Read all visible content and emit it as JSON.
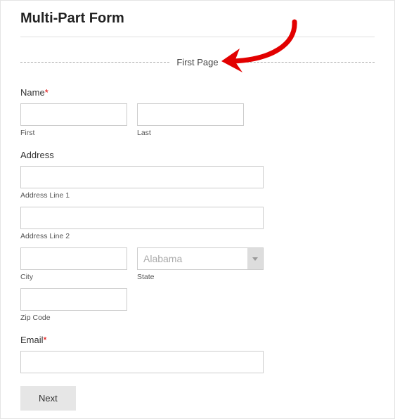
{
  "title": "Multi-Part Form",
  "page_marker": "First Page",
  "name": {
    "label": "Name",
    "required": "*",
    "first_sub": "First",
    "last_sub": "Last"
  },
  "address": {
    "label": "Address",
    "line1_sub": "Address Line 1",
    "line2_sub": "Address Line 2",
    "city_sub": "City",
    "state_sub": "State",
    "state_value": "Alabama",
    "zip_sub": "Zip Code"
  },
  "email": {
    "label": "Email",
    "required": "*"
  },
  "next_label": "Next",
  "colors": {
    "annotation_red": "#e20000"
  }
}
